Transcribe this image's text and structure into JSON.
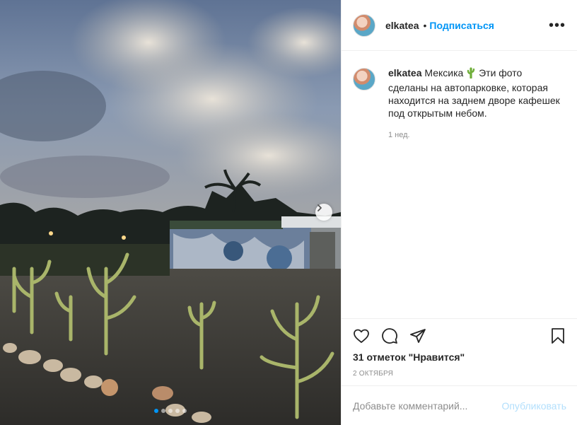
{
  "post": {
    "username": "elkatea",
    "separator": "•",
    "follow_label": "Подписаться",
    "more_label": "•••",
    "caption_username": "elkatea",
    "caption_word": "Мексика",
    "caption_text": "Эти фото сделаны на автопарковке, которая находится на заднем дворе кафешек под открытым небом.",
    "caption_emoji": "cactus",
    "time_ago": "1 нед.",
    "likes": "31 отметок \"Нравится\"",
    "date": "2 ОКТЯБРЯ"
  },
  "comment": {
    "placeholder": "Добавьте комментарий...",
    "publish_label": "Опубликовать"
  },
  "carousel": {
    "total_slides": 5,
    "active_slide": 1
  },
  "icons": {
    "like": "heart-icon",
    "comment": "comment-bubble-icon",
    "share": "paper-plane-icon",
    "save": "bookmark-icon",
    "next": "chevron-right-icon"
  },
  "colors": {
    "accent": "#0095f6",
    "publish_disabled": "#b2dffc",
    "muted": "#8e8e8e"
  }
}
